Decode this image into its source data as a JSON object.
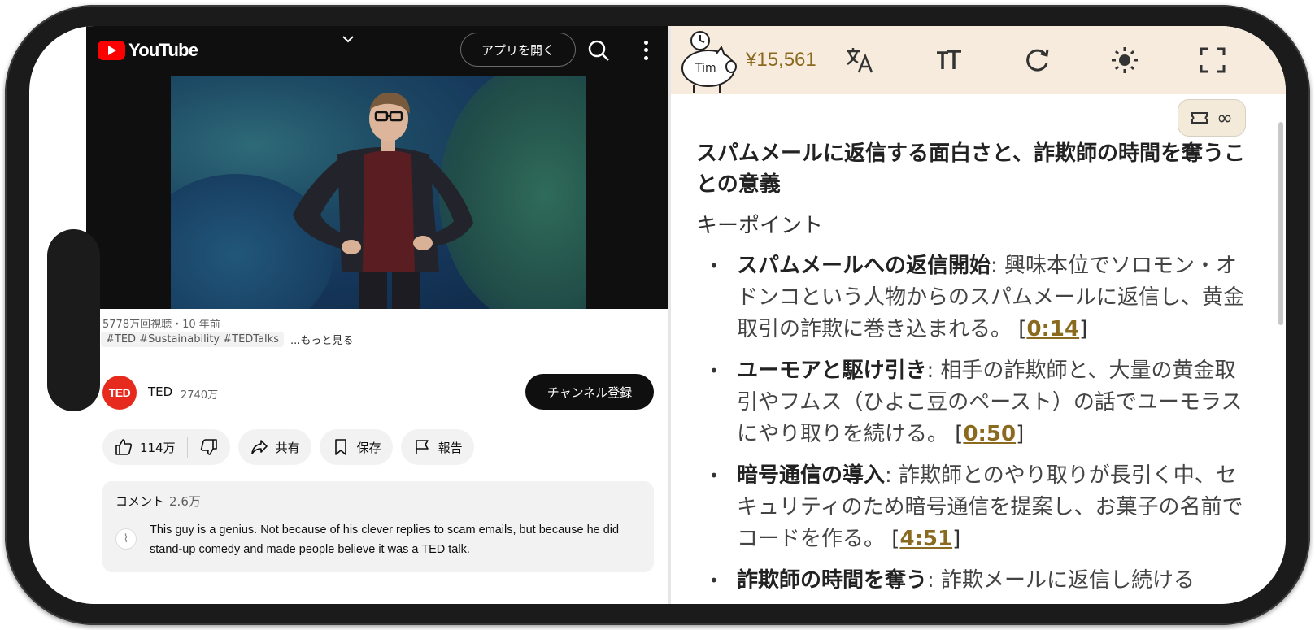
{
  "youtube": {
    "logo_text": "YouTube",
    "open_app_label": "アプリを開く",
    "video": {
      "views_time": "5778万回視聴・10 年前",
      "tags": "#TED #Sustainability #TEDTalks",
      "more_label": "...もっと見る"
    },
    "channel": {
      "logo_text": "TED",
      "name": "TED",
      "subscribers": "2740万",
      "subscribe_label": "チャンネル登録"
    },
    "actions": {
      "likes": "114万",
      "share_label": "共有",
      "save_label": "保存",
      "report_label": "報告"
    },
    "comments": {
      "label": "コメント",
      "count": "2.6万",
      "top_comment": "This guy is a genius. Not because of his clever replies to scam emails, but because he did stand-up comedy and made people believe it was a TED talk."
    }
  },
  "summary": {
    "mascot_label": "Tim",
    "balance": "¥15,561",
    "infinity": "∞",
    "title": "スパムメールに返信する面白さと、詐欺師の時間を奪うことの意義",
    "subtitle": "キーポイント",
    "points": [
      {
        "heading": "スパムメールへの返信開始",
        "text": ": 興味本位でソロモン・オドンコという人物からのスパムメールに返信し、黄金取引の詐欺に巻き込まれる。",
        "timestamp": "0:14"
      },
      {
        "heading": "ユーモアと駆け引き",
        "text": ": 相手の詐欺師と、大量の黄金取引やフムス（ひよこ豆のペースト）の話でユーモラスにやり取りを続ける。",
        "timestamp": "0:50"
      },
      {
        "heading": "暗号通信の導入",
        "text": ": 詐欺師とのやり取りが長引く中、セキュリティのため暗号通信を提案し、お菓子の名前でコードを作る。",
        "timestamp": "4:51"
      },
      {
        "heading": "詐欺師の時間を奪う",
        "text": ": 詐欺メールに返信し続ける",
        "timestamp": ""
      }
    ]
  },
  "colors": {
    "youtube_red": "#ff0000",
    "ted_red": "#e62b1e",
    "summary_bar": "#f6ebdc",
    "timestamp_gold": "#8a6a1f"
  }
}
